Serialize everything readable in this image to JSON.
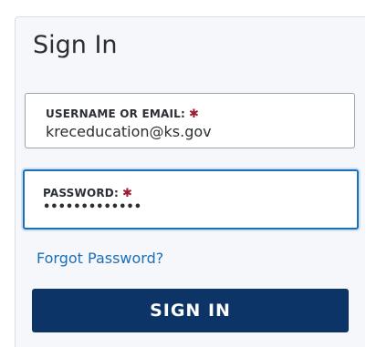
{
  "form": {
    "title": "Sign In",
    "username": {
      "label": "USERNAME OR EMAIL:",
      "required_marker": "✱",
      "value": "kreceducation@ks.gov"
    },
    "password": {
      "label": "PASSWORD:",
      "required_marker": "✱",
      "value": "•••••••••••••"
    },
    "forgot_link": "Forgot Password?",
    "submit_label": "SIGN IN"
  },
  "colors": {
    "accent": "#1b6fb8",
    "button": "#0d3466",
    "required": "#9b1b30"
  }
}
